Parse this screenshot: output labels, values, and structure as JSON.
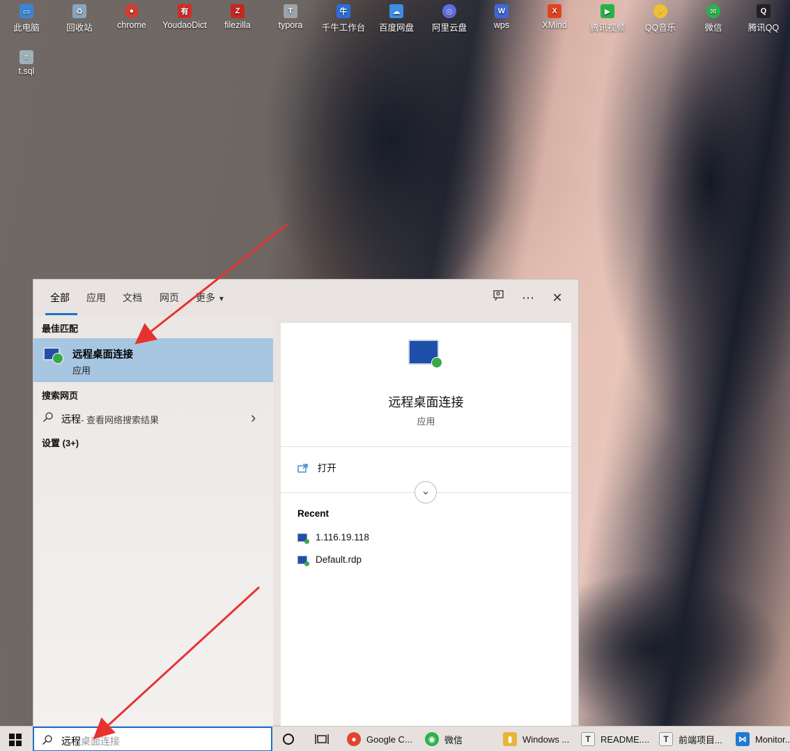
{
  "desktop": {
    "icons": [
      {
        "label": "此电脑",
        "color": "#3a86d6"
      },
      {
        "label": "回收站",
        "color": "#8aa6bf"
      },
      {
        "label": "chrome",
        "color": "#d33b2c"
      },
      {
        "label": "YoudaoDict",
        "color": "#d32b2b"
      },
      {
        "label": "filezilla",
        "color": "#c7261f"
      },
      {
        "label": "typora",
        "color": "#9aa3ab"
      },
      {
        "label": "千牛工作台",
        "color": "#2a6fd6"
      },
      {
        "label": "百度网盘",
        "color": "#3a8ee6"
      },
      {
        "label": "阿里云盘",
        "color": "#5b6ee8"
      },
      {
        "label": "wps",
        "color": "#3f67d9"
      },
      {
        "label": "XMind",
        "color": "#e2421f"
      },
      {
        "label": "腾讯视频",
        "color": "#26b34a"
      },
      {
        "label": "QQ音乐",
        "color": "#f2c02f"
      },
      {
        "label": "微信",
        "color": "#2bb24c"
      },
      {
        "label": "腾讯QQ",
        "color": "#222222"
      },
      {
        "label": "t.sql",
        "color": "#9fb0b8"
      }
    ]
  },
  "search_panel": {
    "tabs": [
      "全部",
      "应用",
      "文档",
      "网页",
      "更多"
    ],
    "more_arrow": "▾",
    "best_match_heading": "最佳匹配",
    "best_match": {
      "name": "远程桌面连接",
      "type": "应用"
    },
    "web_heading": "搜索网页",
    "web_result": {
      "query": "远程",
      "suffix": " - 查看网络搜索结果",
      "chevron": "›"
    },
    "settings_heading": "设置 (3+)",
    "detail": {
      "title": "远程桌面连接",
      "subtitle": "应用",
      "open_label": "打开",
      "expand_glyph": "⌄",
      "recent_heading": "Recent",
      "recent_items": [
        "1.116.19.118",
        "Default.rdp"
      ]
    },
    "toolbar_icons": {
      "feedback": "feedback-icon",
      "more": "⋯",
      "close": "✕"
    }
  },
  "taskbar": {
    "search_query": "远程",
    "search_hint": "桌面连接",
    "apps": [
      {
        "label": "Google C...",
        "color": "#e0452f"
      },
      {
        "label": "微信",
        "color": "#2bb24c"
      },
      {
        "label": "Windows ...",
        "color": "#e8b43a"
      },
      {
        "label": "README....",
        "color": "#6b6b6b"
      },
      {
        "label": "前端项目...",
        "color": "#6b6b6b"
      },
      {
        "label": "Monitor...",
        "color": "#1f7ad1"
      }
    ],
    "app_glyphs": [
      "●",
      "◉",
      "▮",
      "T",
      "T",
      "⋈"
    ]
  },
  "colors": {
    "accent": "#1a73c8",
    "selection": "#a7c6e1",
    "annotation_arrow": "#e8322f"
  }
}
